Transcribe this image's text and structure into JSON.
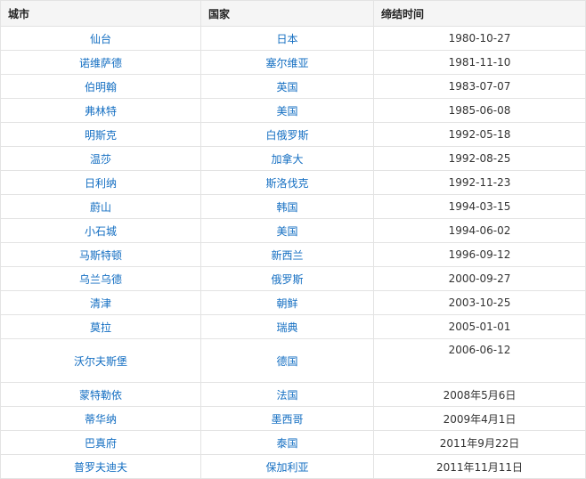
{
  "table": {
    "headers": [
      "城市",
      "国家",
      "缔结时间"
    ],
    "rows": [
      {
        "city": "仙台",
        "country": "日本",
        "date": "1980-10-27"
      },
      {
        "city": "诺维萨德",
        "country": "塞尔维亚",
        "date": "1981-11-10"
      },
      {
        "city": "伯明翰",
        "country": "英国",
        "date": "1983-07-07"
      },
      {
        "city": "弗林特",
        "country": "美国",
        "date": "1985-06-08"
      },
      {
        "city": "明斯克",
        "country": "白俄罗斯",
        "date": "1992-05-18"
      },
      {
        "city": "温莎",
        "country": "加拿大",
        "date": "1992-08-25"
      },
      {
        "city": "日利纳",
        "country": "斯洛伐克",
        "date": "1992-11-23"
      },
      {
        "city": "蔚山",
        "country": "韩国",
        "date": "1994-03-15"
      },
      {
        "city": "小石城",
        "country": "美国",
        "date": "1994-06-02"
      },
      {
        "city": "马斯特顿",
        "country": "新西兰",
        "date": "1996-09-12"
      },
      {
        "city": "乌兰乌德",
        "country": "俄罗斯",
        "date": "2000-09-27"
      },
      {
        "city": "清津",
        "country": "朝鲜",
        "date": "2003-10-25"
      },
      {
        "city": "莫拉",
        "country": "瑞典",
        "date": "2005-01-01"
      },
      {
        "city": "沃尔夫斯堡",
        "country": "德国",
        "date": "2006-06-12"
      },
      {
        "city": "蒙特勒依",
        "country": "法国",
        "date": "2008年5月6日"
      },
      {
        "city": "蒂华纳",
        "country": "墨西哥",
        "date": "2009年4月1日"
      },
      {
        "city": "巴真府",
        "country": "泰国",
        "date": "2011年9月22日"
      },
      {
        "city": "普罗夫迪夫",
        "country": "保加利亚",
        "date": "2011年11月11日"
      }
    ]
  },
  "colors": {
    "header_bg": "#f5f5f5",
    "border": "#e3e3e3",
    "link": "#136ec2",
    "text": "#333333"
  }
}
